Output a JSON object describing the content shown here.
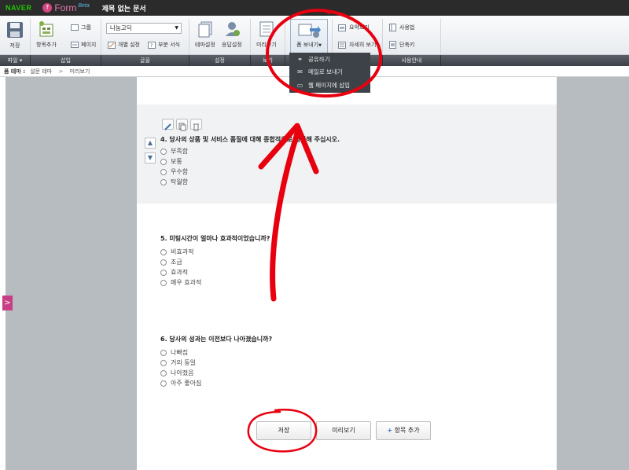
{
  "topbar": {
    "naver": "NAVER",
    "form_icon": "f",
    "form_word": "Form",
    "beta": "Beta",
    "doc_title": "제목 없는 문서"
  },
  "ribbon": {
    "save": "저장",
    "add_item": "항목추가",
    "group": "그룹",
    "page": "페이지",
    "font_select": "나눔고딕",
    "individual_setting": "개별 설정",
    "partial_format": "부분 서식",
    "theme_setting": "테마설정",
    "response_setting": "응답설정",
    "preview": "미리보기",
    "send_form": "폼 보내기",
    "summary_view": "요약보기",
    "detail_view": "자세히 보기",
    "usage": "사용법",
    "shortcuts": "단축키"
  },
  "sections": [
    "파일",
    "삽입",
    "글꼴",
    "설정",
    "보기",
    "",
    "사용안내"
  ],
  "breadcrumb": {
    "label": "폼 테마 :",
    "theme": "설문 테마",
    "sep": ">",
    "current": "미리보기"
  },
  "dropdown": [
    {
      "icon": "link-icon",
      "label": "공유하기"
    },
    {
      "icon": "mail-icon",
      "label": "메일로 보내기"
    },
    {
      "icon": "embed-icon",
      "label": "웹 페이지에 삽입"
    }
  ],
  "questions": [
    {
      "title": "4. 당사의 상품 및 서비스 품질에 대해 종합적으로 평가해 주십시오.",
      "options": [
        "부족함",
        "보통",
        "우수함",
        "탁월함"
      ]
    },
    {
      "title": "5. 미팅시간이 얼마나 효과적이었습니까?",
      "options": [
        "비효과적",
        "조금",
        "효과적",
        "매우 효과적"
      ]
    },
    {
      "title": "6. 당사의 성과는 이전보다 나아졌습니까?",
      "options": [
        "나빠짐",
        "거의 동일",
        "나아졌음",
        "아주 좋아짐"
      ]
    }
  ],
  "buttons": {
    "save": "저장",
    "preview": "미리보기",
    "add_item": "항목 추가",
    "plus": "+"
  },
  "side_tab": ">",
  "arrows": {
    "up": "▲",
    "down": "▼"
  },
  "colors": {
    "accent": "#c83e86",
    "annotation": "#e8000f"
  }
}
